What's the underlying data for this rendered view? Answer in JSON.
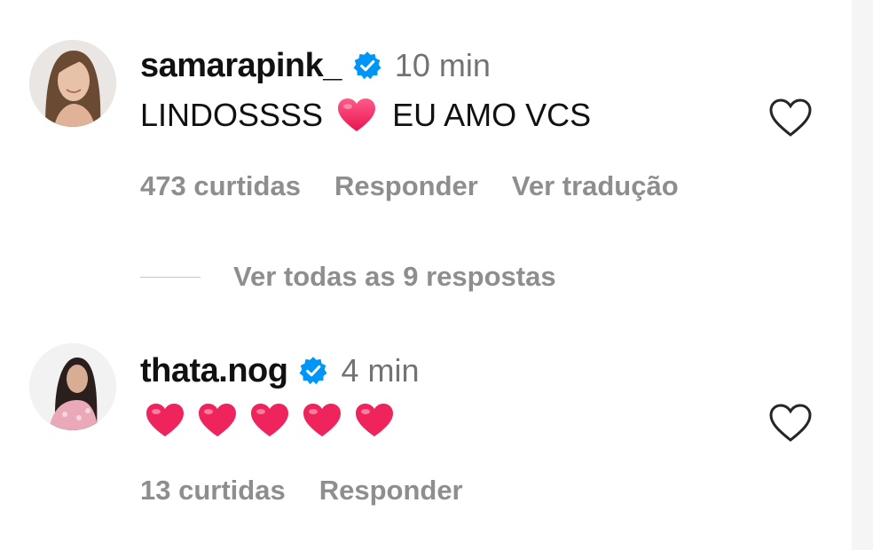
{
  "comments": [
    {
      "username": "samarapink_",
      "verified_icon": "verified-badge-icon",
      "timestamp": "10 min",
      "text_before": "LINDOSSSS",
      "text_after": "EU AMO VCS",
      "emoji": "heart-emoji",
      "likes": "473 curtidas",
      "reply_label": "Responder",
      "translate_label": "Ver tradução",
      "like_icon": "heart-outline-icon"
    },
    {
      "username": "thata.nog",
      "verified_icon": "verified-badge-icon",
      "timestamp": "4 min",
      "emoji_count": 5,
      "emoji": "heart-emoji",
      "likes": "13 curtidas",
      "reply_label": "Responder",
      "like_icon": "heart-outline-icon"
    }
  ],
  "replies_toggle": {
    "label": "Ver todas as 9 respostas"
  },
  "colors": {
    "verified": "#0095f6",
    "muted_text": "#737373",
    "meta_text": "#8e8e8e",
    "heart_emoji": "#f0245d"
  }
}
